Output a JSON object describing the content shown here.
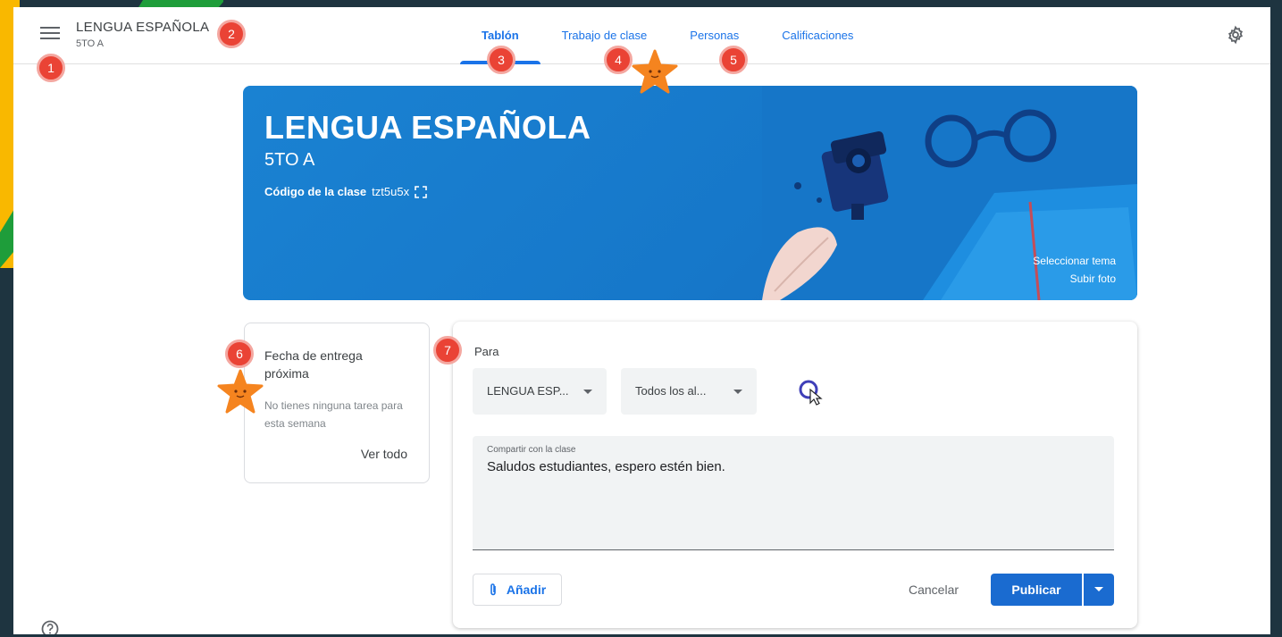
{
  "header": {
    "course_title": "LENGUA ESPAÑOLA",
    "course_section": "5TO A",
    "tabs": [
      {
        "label": "Tablón",
        "active": true
      },
      {
        "label": "Trabajo de clase",
        "active": false
      },
      {
        "label": "Personas",
        "active": false
      },
      {
        "label": "Calificaciones",
        "active": false
      }
    ]
  },
  "banner": {
    "title": "LENGUA ESPAÑOLA",
    "section": "5TO A",
    "code_label": "Código de la clase",
    "code_value": "tzt5u5x",
    "select_theme": "Seleccionar tema",
    "upload_photo": "Subir foto"
  },
  "upcoming": {
    "title": "Fecha de entrega próxima",
    "empty_text": "No tienes ninguna tarea para esta semana",
    "view_all": "Ver todo"
  },
  "composer": {
    "for_label": "Para",
    "class_select": "LENGUA ESP...",
    "students_select": "Todos los al...",
    "share_label": "Compartir con la clase",
    "share_text": "Saludos estudiantes, espero estén bien.",
    "add_label": "Añadir",
    "cancel_label": "Cancelar",
    "publish_label": "Publicar"
  },
  "annotations": [
    "1",
    "2",
    "3",
    "4",
    "5",
    "6",
    "7"
  ],
  "colors": {
    "accent": "#1a73e8",
    "banner": "#1a82d2",
    "badge": "#ea4335",
    "star": "#f5841f",
    "frame": "#1e3440"
  }
}
